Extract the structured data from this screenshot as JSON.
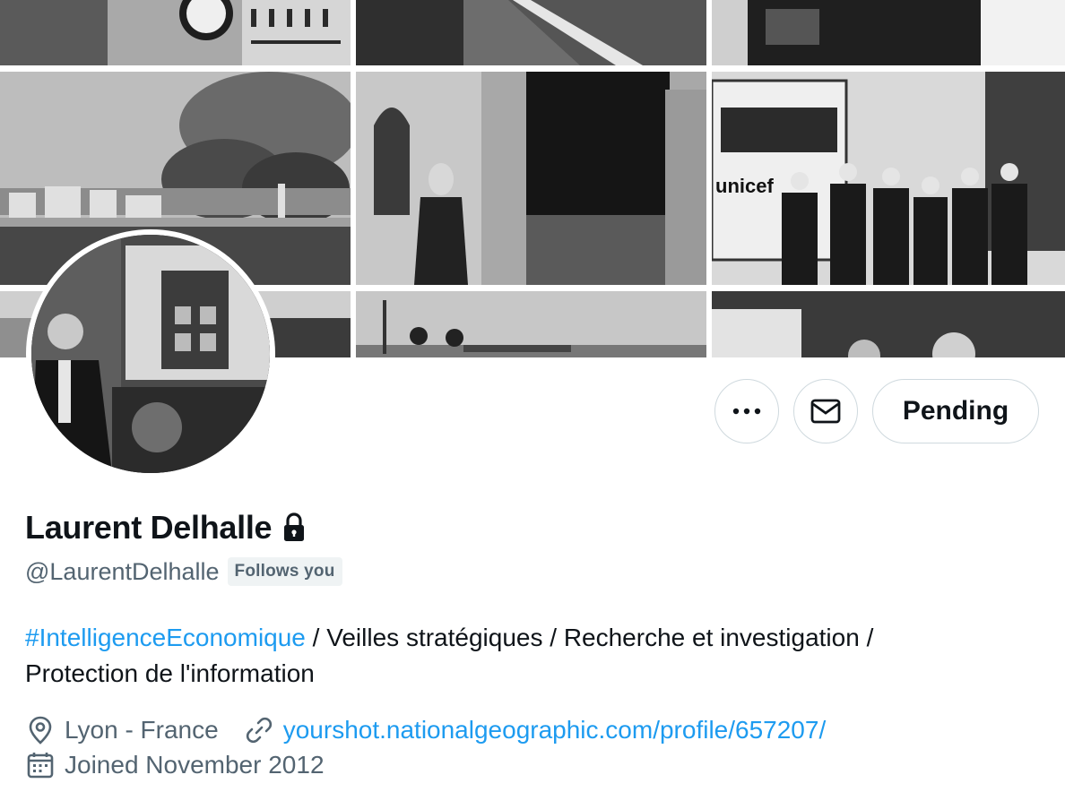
{
  "banner": {
    "tiles": [
      {
        "name": "photo-children-sweater"
      },
      {
        "name": "photo-road"
      },
      {
        "name": "photo-man-camera"
      },
      {
        "name": "photo-burning-city"
      },
      {
        "name": "photo-boy-doorway"
      },
      {
        "name": "photo-unicef-truck"
      },
      {
        "name": "photo-bottom-left"
      },
      {
        "name": "photo-bottom-middle"
      },
      {
        "name": "photo-bottom-right"
      }
    ],
    "truck_text": "unicef"
  },
  "profile": {
    "display_name": "Laurent Delhalle",
    "handle": "@LaurentDelhalle",
    "follows_you_badge": "Follows you",
    "protected_icon": "lock-icon",
    "bio": {
      "hashtag": "#IntelligenceEconomique",
      "text_line1": " / Veilles stratégiques / Recherche et investigation /",
      "text_line2": "Protection de l'information"
    },
    "location": "Lyon - France",
    "website": "yourshot.nationalgeographic.com/profile/657207/",
    "joined": "Joined November 2012"
  },
  "actions": {
    "more_icon": "more-icon",
    "message_icon": "envelope-icon",
    "pending_label": "Pending"
  },
  "colors": {
    "accent": "#1d9bf0",
    "secondary_text": "#536471",
    "border": "#cfd9de",
    "badge_bg": "#eff3f4"
  }
}
